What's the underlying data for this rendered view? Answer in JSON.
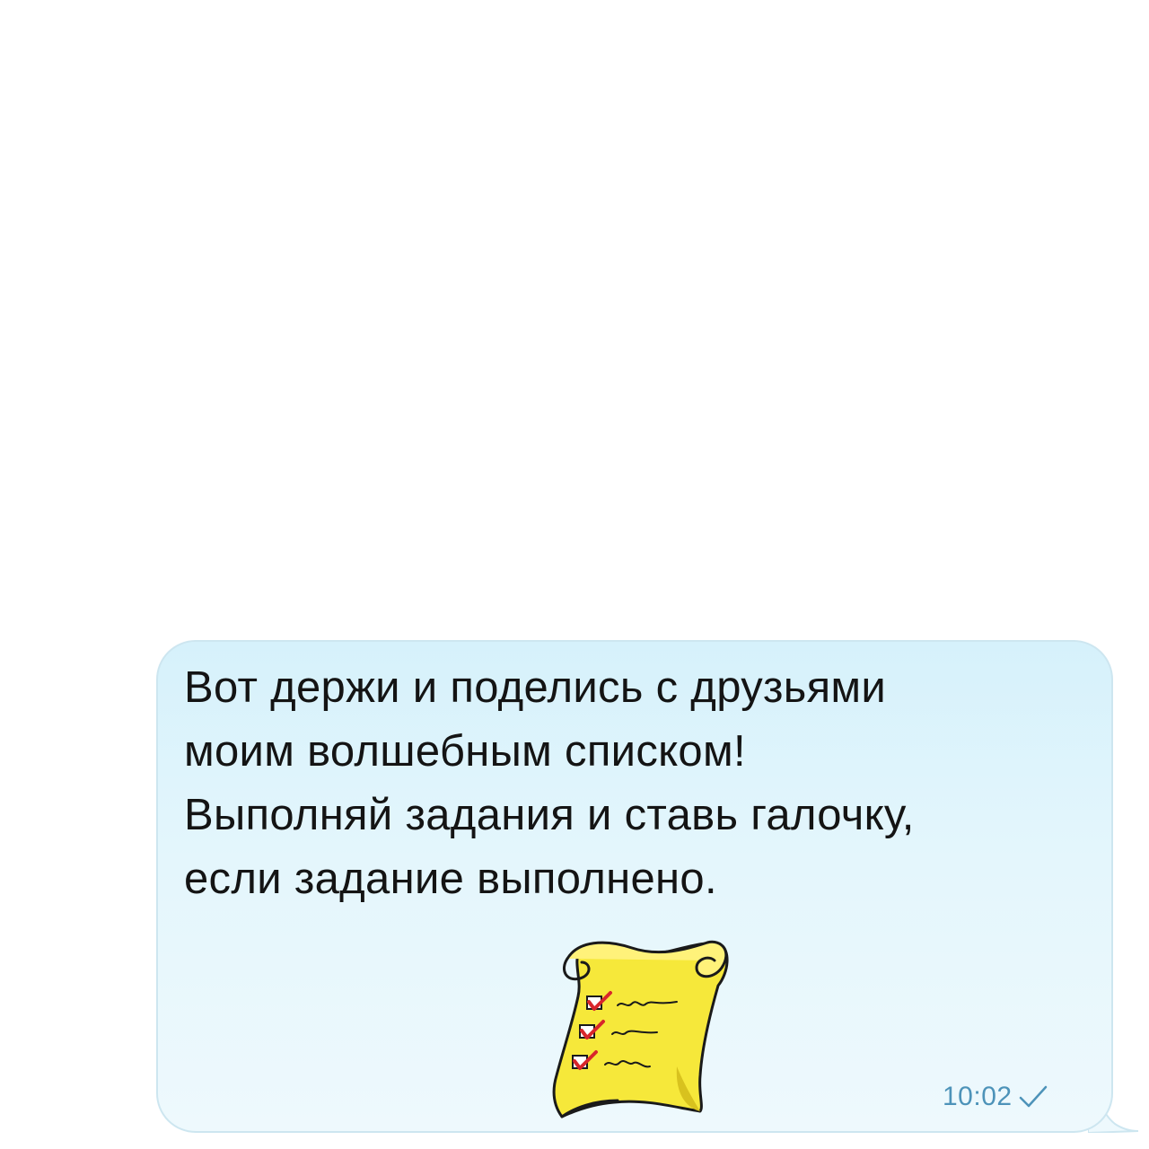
{
  "message": {
    "lines": [
      "Вот держи и поделись с друзьями",
      "моим волшебным списком!",
      "Выполняй задания и ставь галочку,",
      "если задание выполнено."
    ],
    "sticker_icon": "checklist-scroll-icon",
    "time": "10:02",
    "status_icon": "single-check-icon"
  },
  "colors": {
    "bubble": "#dff4fc",
    "text": "#141414",
    "time": "#4d93b9",
    "scroll": "#f6e83a",
    "check_mark": "#d8262b"
  }
}
